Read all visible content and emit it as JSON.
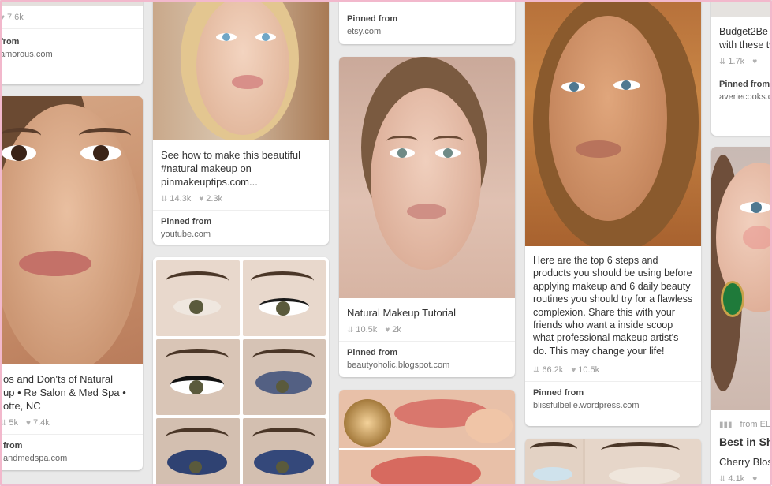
{
  "col1": {
    "card1": {
      "stat_views": "7.6k",
      "pinned_label": "from",
      "source": "amorous.com"
    },
    "card2": {
      "desc": "os and Don'ts of Natural\nup • Re Salon & Med Spa •\notte, NC",
      "stat_repins": "5k",
      "stat_likes": "7.4k",
      "pinned_label": "from",
      "source": "andmedspa.com"
    }
  },
  "col2": {
    "card1": {
      "desc": "See how to make this beautiful #natural makeup on pinmakeuptips.com...",
      "stat_repins": "14.3k",
      "stat_likes": "2.3k",
      "pinned_label": "Pinned from",
      "source": "youtube.com"
    }
  },
  "col3": {
    "card0": {
      "pinned_label": "Pinned from",
      "source": "etsy.com"
    },
    "card1": {
      "desc": "Natural Makeup Tutorial",
      "stat_repins": "10.5k",
      "stat_likes": "2k",
      "pinned_label": "Pinned from",
      "source": "beautyoholic.blogspot.com"
    }
  },
  "col4": {
    "card1": {
      "desc": "Here are the top 6 steps and products you should be using before applying makeup and 6 daily beauty routines you should try for a flawless complexion. Share this with your friends who want a inside scoop what professional makeup artist's do. This may change your life!",
      "stat_repins": "66.2k",
      "stat_likes": "10.5k",
      "pinned_label": "Pinned from",
      "source": "blissfulbelle.wordpress.com"
    }
  },
  "col5": {
    "card1": {
      "desc": "Budget2Be beauty pr with these tweaks!",
      "stat_repins": "1.7k",
      "pinned_label": "Pinned from",
      "source": "averiecooks.c"
    },
    "card2": {
      "from_label": "from ELL",
      "desc": "Best in Sh",
      "sub": "Cherry Blos",
      "stat_repins": "4.1k"
    }
  },
  "icons": {
    "repin": "⇊",
    "like": "♥"
  },
  "colors": {
    "frame": "#f2b8cc",
    "background": "#e9e9e9"
  }
}
